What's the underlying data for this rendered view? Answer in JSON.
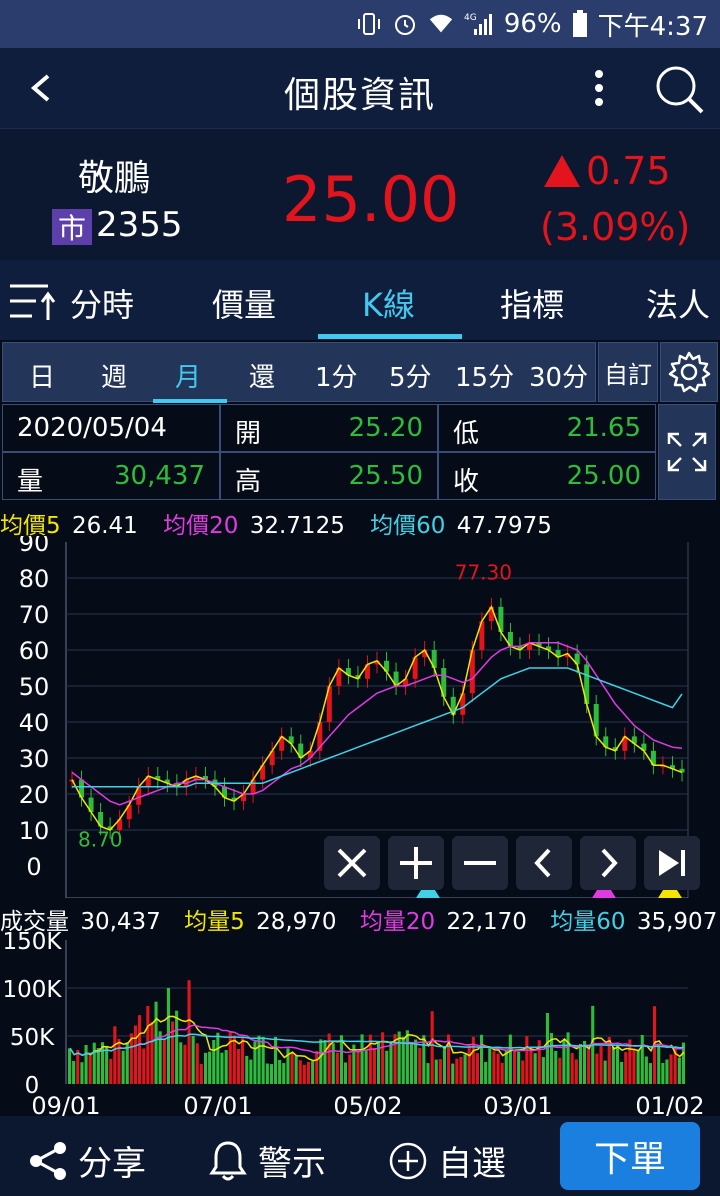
{
  "status_bar": {
    "battery": "96%",
    "time": "下午4:37",
    "network": "4G"
  },
  "app_bar": {
    "title": "個股資訊"
  },
  "quote": {
    "name": "敬鵬",
    "market": "市",
    "code": "2355",
    "price": "25.00",
    "change": "0.75",
    "change_pct": "(3.09%)",
    "up_color": "#e3141b"
  },
  "tabs": [
    {
      "label": "分時"
    },
    {
      "label": "價量"
    },
    {
      "label": "K線",
      "active": true
    },
    {
      "label": "指標"
    },
    {
      "label": "法人"
    }
  ],
  "periods": [
    {
      "label": "日"
    },
    {
      "label": "週"
    },
    {
      "label": "月",
      "active": true
    },
    {
      "label": "還"
    },
    {
      "label": "1分"
    },
    {
      "label": "5分"
    },
    {
      "label": "15分"
    },
    {
      "label": "30分"
    }
  ],
  "custom_label": "自訂",
  "info": {
    "date": "2020/05/04",
    "open_label": "開",
    "open": "25.20",
    "low_label": "低",
    "low": "21.65",
    "volume_label": "量",
    "volume": "30,437",
    "high_label": "高",
    "high": "25.50",
    "close_label": "收",
    "close": "25.00"
  },
  "ma_legend": [
    {
      "label": "均價5",
      "value": "26.41",
      "color": "#f2e600"
    },
    {
      "label": "均價20",
      "value": "32.7125",
      "color": "#e03be0"
    },
    {
      "label": "均價60",
      "value": "47.7975",
      "color": "#3fd2e6"
    }
  ],
  "vol_legend": [
    {
      "label": "成交量",
      "value": "30,437",
      "color": "#ffffff"
    },
    {
      "label": "均量5",
      "value": "28,970",
      "color": "#f2e600"
    },
    {
      "label": "均量20",
      "value": "22,170",
      "color": "#e03be0"
    },
    {
      "label": "均量60",
      "value": "35,907",
      "color": "#3fd2e6"
    }
  ],
  "chart_data": [
    {
      "type": "line",
      "title": "",
      "y_ticks": [
        "90",
        "80",
        "70",
        "60",
        "50",
        "40",
        "30",
        "20",
        "10",
        "0"
      ],
      "ylim": [
        0,
        90
      ],
      "annotations": [
        {
          "label": "77.30",
          "note": "high"
        },
        {
          "label": "8.70",
          "note": "low"
        }
      ],
      "series": [
        {
          "name": "均價5",
          "color": "#f2e600",
          "values": [
            24,
            19,
            15,
            11,
            10,
            13,
            17,
            22,
            25,
            24,
            23,
            22,
            24,
            25,
            24,
            22,
            19,
            18,
            20,
            24,
            28,
            32,
            36,
            34,
            30,
            32,
            40,
            50,
            55,
            53,
            52,
            56,
            57,
            54,
            50,
            52,
            58,
            60,
            55,
            47,
            42,
            48,
            60,
            68,
            72,
            65,
            61,
            60,
            62,
            61,
            60,
            58,
            59,
            56,
            45,
            36,
            33,
            32,
            36,
            34,
            32,
            28,
            28,
            27,
            26
          ]
        },
        {
          "name": "均價20",
          "color": "#e03be0",
          "values": [
            26,
            24,
            22,
            20,
            18,
            17,
            18,
            19,
            20,
            21,
            22,
            23,
            23,
            24,
            24,
            23,
            22,
            21,
            20,
            20,
            21,
            23,
            25,
            27,
            28,
            30,
            33,
            36,
            39,
            42,
            44,
            46,
            48,
            49,
            50,
            50,
            51,
            52,
            53,
            53,
            52,
            51,
            52,
            55,
            58,
            60,
            61,
            61,
            62,
            62,
            62,
            62,
            61,
            60,
            57,
            53,
            49,
            45,
            42,
            39,
            37,
            35,
            34,
            33,
            32.7
          ]
        },
        {
          "name": "均價60",
          "color": "#3fd2e6",
          "values": [
            22,
            22,
            22,
            22,
            22,
            22,
            22,
            22,
            22,
            22,
            22,
            22,
            22,
            23,
            23,
            23,
            23,
            23,
            23,
            23,
            23,
            24,
            25,
            26,
            27,
            28,
            29,
            30,
            31,
            32,
            33,
            34,
            35,
            36,
            37,
            38,
            39,
            40,
            41,
            42,
            43,
            44,
            46,
            48,
            50,
            52,
            53,
            54,
            55,
            55,
            55,
            55,
            55,
            54,
            53,
            52,
            51,
            50,
            49,
            48,
            47,
            46,
            45,
            44,
            47.8
          ]
        }
      ]
    },
    {
      "type": "bar",
      "title": "",
      "y_ticks": [
        "150K",
        "100K",
        "50K",
        "0"
      ],
      "ylim": [
        0,
        150000
      ],
      "x_ticks": [
        "09/01",
        "07/01",
        "05/02",
        "03/01",
        "01/02"
      ],
      "series": [
        {
          "name": "均量5",
          "color": "#f2e600"
        },
        {
          "name": "均量20",
          "color": "#e03be0"
        },
        {
          "name": "均量60",
          "color": "#3fd2e6"
        }
      ]
    }
  ],
  "controls": [
    {
      "name": "close"
    },
    {
      "name": "zoom-in"
    },
    {
      "name": "zoom-out"
    },
    {
      "name": "prev"
    },
    {
      "name": "next"
    },
    {
      "name": "last"
    }
  ],
  "bottom_bar": {
    "share": "分享",
    "alert": "警示",
    "watchlist": "自選",
    "order": "下單"
  }
}
